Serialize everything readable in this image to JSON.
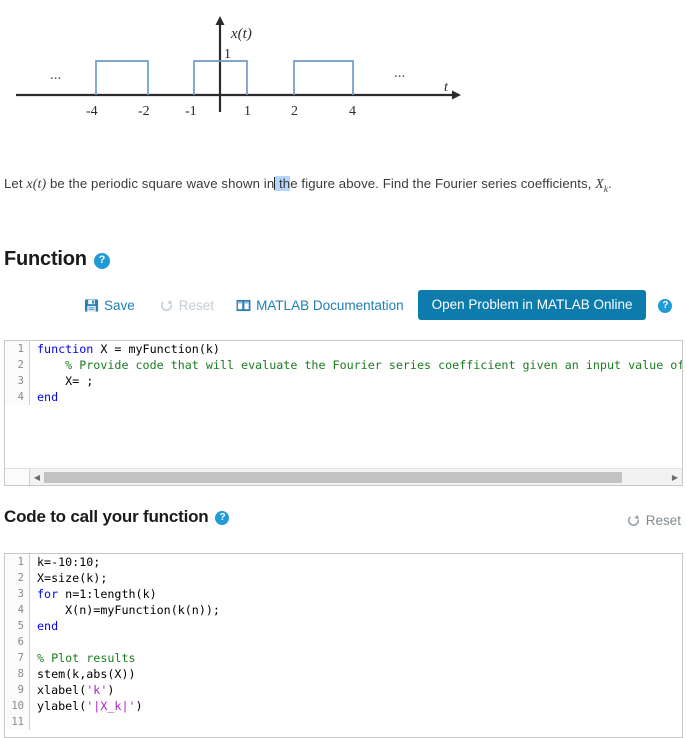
{
  "figure": {
    "name": "periodic-square-wave-plot",
    "y_axis_label": "x(t)",
    "x_axis_label": "t",
    "amplitude_label": "1",
    "x_tick_labels": [
      "-4",
      "-2",
      "-1",
      "1",
      "2",
      "4"
    ],
    "ellipsis_left": "...",
    "ellipsis_right": "...",
    "pulse_color": "#6e9bc5",
    "axis_color": "#2b2b2b"
  },
  "chart_data": {
    "type": "line",
    "title": "",
    "xlabel": "t",
    "ylabel": "x(t)",
    "description": "Periodic square wave, period 3, amplitude 1, pulses from -1 to 1 repeating",
    "amplitude": 1,
    "period": 3,
    "pulse_width": 2,
    "x_ticks": [
      -4,
      -2,
      -1,
      1,
      2,
      4
    ],
    "xlim": [
      -6.2,
      6.2
    ],
    "ylim": [
      0,
      1.45
    ],
    "grid": false,
    "legend": null,
    "pulses": [
      {
        "start": -4,
        "end": -2,
        "value": 1
      },
      {
        "start": -1,
        "end": 1,
        "value": 1
      },
      {
        "start": 2,
        "end": 4,
        "value": 1
      }
    ],
    "x": [
      -6,
      -4,
      -4,
      -2,
      -2,
      -1,
      -1,
      1,
      1,
      2,
      2,
      4,
      4,
      6
    ],
    "y": [
      0,
      0,
      1,
      1,
      0,
      0,
      1,
      1,
      0,
      0,
      1,
      1,
      0,
      0
    ]
  },
  "problem": {
    "before_var": "Let ",
    "var": "x(t)",
    "mid1": " be the periodic square wave shown in",
    "selected": " th",
    "mid2": "e figure above.  Find the Fourier series coefficients, ",
    "coefficient": "X",
    "coefficient_sub": "k",
    "end": ".",
    "selection_color": "#b4d5fe"
  },
  "function_section": {
    "title": "Function",
    "help_label": "?",
    "toolbar": {
      "save_label": "Save",
      "save_icon": "floppy-disk-icon",
      "reset_label": "Reset",
      "reset_icon": "refresh-icon",
      "reset_disabled": true,
      "docs_label": "MATLAB Documentation",
      "docs_icon": "book-icon",
      "open_online_label": "Open Problem in MATLAB Online",
      "open_online_color": "#0d7bab",
      "trailing_help_label": "?"
    },
    "code_lines": [
      {
        "n": "1",
        "tokens": [
          {
            "t": "function",
            "c": "kw"
          },
          {
            "t": " X = myFunction(k)",
            "c": "pl"
          }
        ]
      },
      {
        "n": "2",
        "tokens": [
          {
            "t": "    % Provide code that will evaluate the Fourier series coefficient given an input value of",
            "c": "cm"
          }
        ]
      },
      {
        "n": "3",
        "tokens": [
          {
            "t": "    X= ;",
            "c": "pl"
          }
        ]
      },
      {
        "n": "4",
        "tokens": [
          {
            "t": "end",
            "c": "kw"
          }
        ]
      }
    ],
    "scrollbar": {
      "left_arrow": "◀",
      "right_arrow": "▶"
    }
  },
  "caller_section": {
    "title": "Code to call your function",
    "help_label": "?",
    "reset_label": "Reset",
    "reset_icon": "refresh-icon",
    "code_lines": [
      {
        "n": "1",
        "tokens": [
          {
            "t": "k=-10:10;",
            "c": "pl"
          }
        ]
      },
      {
        "n": "2",
        "tokens": [
          {
            "t": "X=size(k);",
            "c": "pl"
          }
        ]
      },
      {
        "n": "3",
        "tokens": [
          {
            "t": "for",
            "c": "kw"
          },
          {
            "t": " n=1:length(k)",
            "c": "pl"
          }
        ]
      },
      {
        "n": "4",
        "tokens": [
          {
            "t": "    X(n)=myFunction(k(n));",
            "c": "pl"
          }
        ]
      },
      {
        "n": "5",
        "tokens": [
          {
            "t": "end",
            "c": "kw"
          }
        ]
      },
      {
        "n": "6",
        "tokens": [
          {
            "t": "",
            "c": "pl"
          }
        ]
      },
      {
        "n": "7",
        "tokens": [
          {
            "t": "% Plot results",
            "c": "cm"
          }
        ]
      },
      {
        "n": "8",
        "tokens": [
          {
            "t": "stem(k,abs(X))",
            "c": "pl"
          }
        ]
      },
      {
        "n": "9",
        "tokens": [
          {
            "t": "xlabel(",
            "c": "pl"
          },
          {
            "t": "'k'",
            "c": "st"
          },
          {
            "t": ")",
            "c": "pl"
          }
        ]
      },
      {
        "n": "10",
        "tokens": [
          {
            "t": "ylabel(",
            "c": "pl"
          },
          {
            "t": "'|X_k|'",
            "c": "st"
          },
          {
            "t": ")",
            "c": "pl"
          }
        ]
      },
      {
        "n": "11",
        "tokens": [
          {
            "t": "",
            "c": "pl"
          }
        ]
      }
    ]
  },
  "colors": {
    "accent_blue": "#1f7fb5",
    "button_blue": "#0d7bab",
    "help_blue": "#1f9bd7",
    "disabled_gray": "#c3cdd4",
    "keyword_blue": "#0000ff",
    "comment_green": "#1a7d20",
    "string_purple": "#aa23c9"
  }
}
